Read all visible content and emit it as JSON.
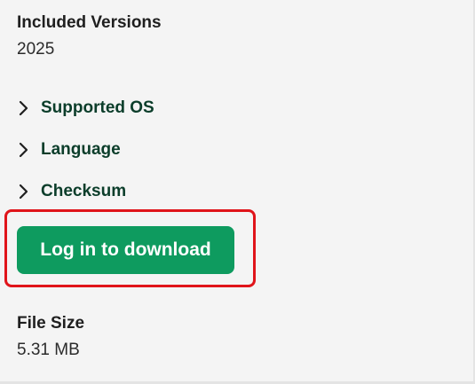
{
  "included_versions": {
    "label": "Included Versions",
    "value": "2025"
  },
  "expanders": [
    {
      "label": "Supported OS",
      "icon": "chevron-right-icon"
    },
    {
      "label": "Language",
      "icon": "chevron-right-icon"
    },
    {
      "label": "Checksum",
      "icon": "chevron-right-icon"
    }
  ],
  "download": {
    "label": "Log in to download",
    "color": "#0e9b5f",
    "highlight_color": "#e0141a"
  },
  "file_size": {
    "label": "File Size",
    "value": "5.31 MB"
  }
}
